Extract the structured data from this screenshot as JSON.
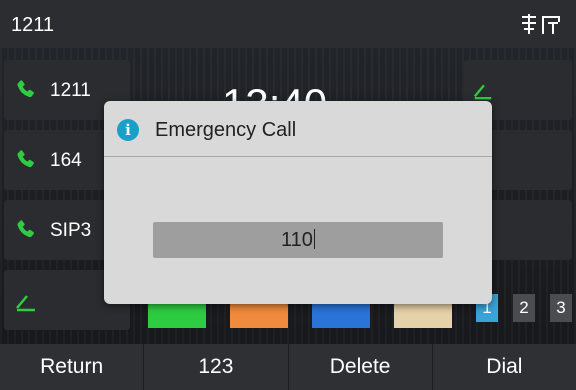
{
  "status_bar": {
    "account": "1211",
    "network_icon": "network-icon"
  },
  "line_keys": [
    {
      "label": "1211",
      "icon": "phone-icon"
    },
    {
      "label": "164",
      "icon": "phone-icon"
    },
    {
      "label": "SIP3",
      "icon": "phone-icon"
    },
    {
      "label": "",
      "icon": "edit-icon"
    }
  ],
  "clock": "13:40",
  "pager": [
    "1",
    "2",
    "3"
  ],
  "dialog": {
    "title": "Emergency Call",
    "icon": "info-icon",
    "input_value": "110"
  },
  "softkeys": [
    "Return",
    "123",
    "Delete",
    "Dial"
  ],
  "colors": {
    "accent": "#1aa0c8",
    "phone_green": "#2ecc40",
    "page_active": "#3aa3d8"
  }
}
